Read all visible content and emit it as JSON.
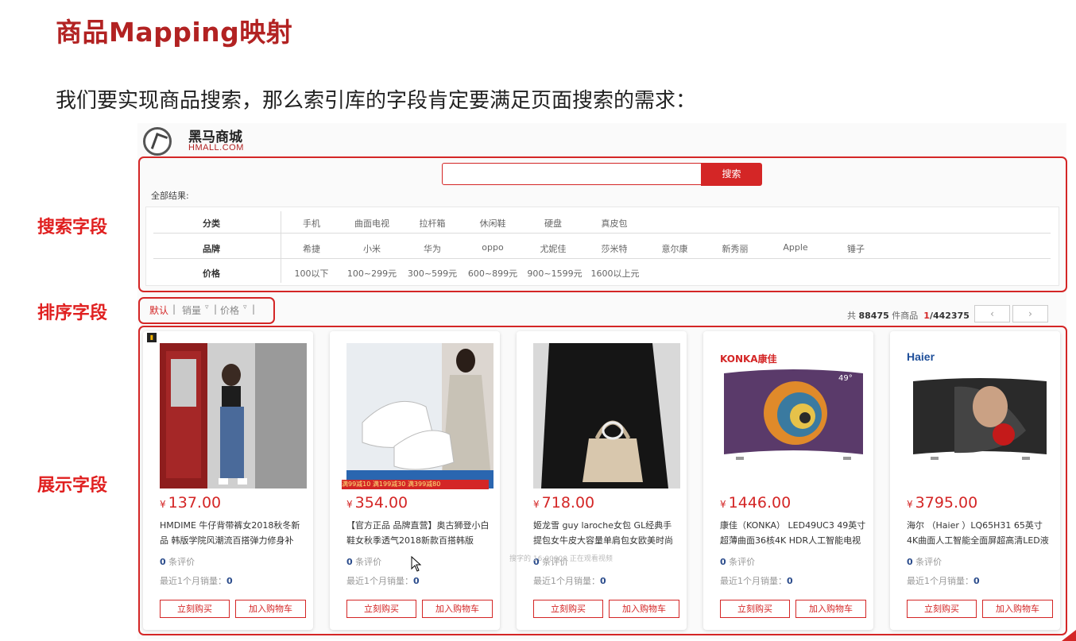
{
  "title": "商品Mapping映射",
  "subtitle": "我们要实现商品搜索，那么索引库的字段肯定要满足页面搜索的需求：",
  "side_labels": {
    "search": "搜索字段",
    "sort": "排序字段",
    "display": "展示字段"
  },
  "logo": {
    "cn": "黑马商城",
    "en": "HMALL.COM"
  },
  "search": {
    "button": "搜索",
    "value": ""
  },
  "all_results": "全部结果:",
  "filters": [
    {
      "label": "分类",
      "options": [
        "手机",
        "曲面电视",
        "拉杆箱",
        "休闲鞋",
        "硬盘",
        "真皮包"
      ]
    },
    {
      "label": "品牌",
      "options": [
        "希捷",
        "小米",
        "华为",
        "oppo",
        "尤妮佳",
        "莎米特",
        "意尔康",
        "新秀丽",
        "Apple",
        "锤子"
      ]
    },
    {
      "label": "价格",
      "options": [
        "100以下",
        "100~299元",
        "300~599元",
        "600~899元",
        "900~1599元",
        "1600以上元"
      ]
    }
  ],
  "sort": {
    "default": "默认",
    "sales": "销量",
    "price": "价格",
    "sep": "|",
    "arrow": "▿"
  },
  "result_count": {
    "prefix": "共",
    "count": "88475",
    "suffix": "件商品",
    "page": "1",
    "total": "/442375"
  },
  "pager": {
    "prev": "‹",
    "next": "›"
  },
  "products": [
    {
      "price": "137.00",
      "name": "HMDIME 牛仔背带裤女2018秋冬新品 韩版学院风潮流百搭弹力修身补",
      "reviews": "0",
      "sales": "0"
    },
    {
      "price": "354.00",
      "name": "【官方正品 品牌直营】奥古狮登小白鞋女秋季透气2018新款百搭韩版",
      "reviews": "0",
      "sales": "0"
    },
    {
      "price": "718.00",
      "name": "姬龙雪 guy laroche女包 GL经典手提包女牛皮大容量单肩包女欧美时尚包",
      "reviews": "0",
      "sales": "0"
    },
    {
      "price": "1446.00",
      "name": "康佳（KONKA） LED49UC3 49英寸 超薄曲面36核4K HDR人工智能电视",
      "reviews": "0",
      "sales": "0"
    },
    {
      "price": "3795.00",
      "name": "海尔 （Haier ）LQ65H31 65英寸 4K曲面人工智能全面屏超高清LED液晶",
      "reviews": "0",
      "sales": "0"
    }
  ],
  "card_text": {
    "yen": "¥",
    "reviews_suffix": "条评价",
    "sales_prefix": "最近1个月销量：",
    "buy": "立刻购买",
    "cart": "加入购物车"
  },
  "brands": {
    "konka": "KONKA康佳",
    "haier": "Haier",
    "tv_size": "49°"
  },
  "promo": "满99减10 满199减30 满399减80",
  "watermark": "搜字的 16:00000 正在观看视频",
  "colors": {
    "accent": "#d42626",
    "title": "#b22222"
  }
}
